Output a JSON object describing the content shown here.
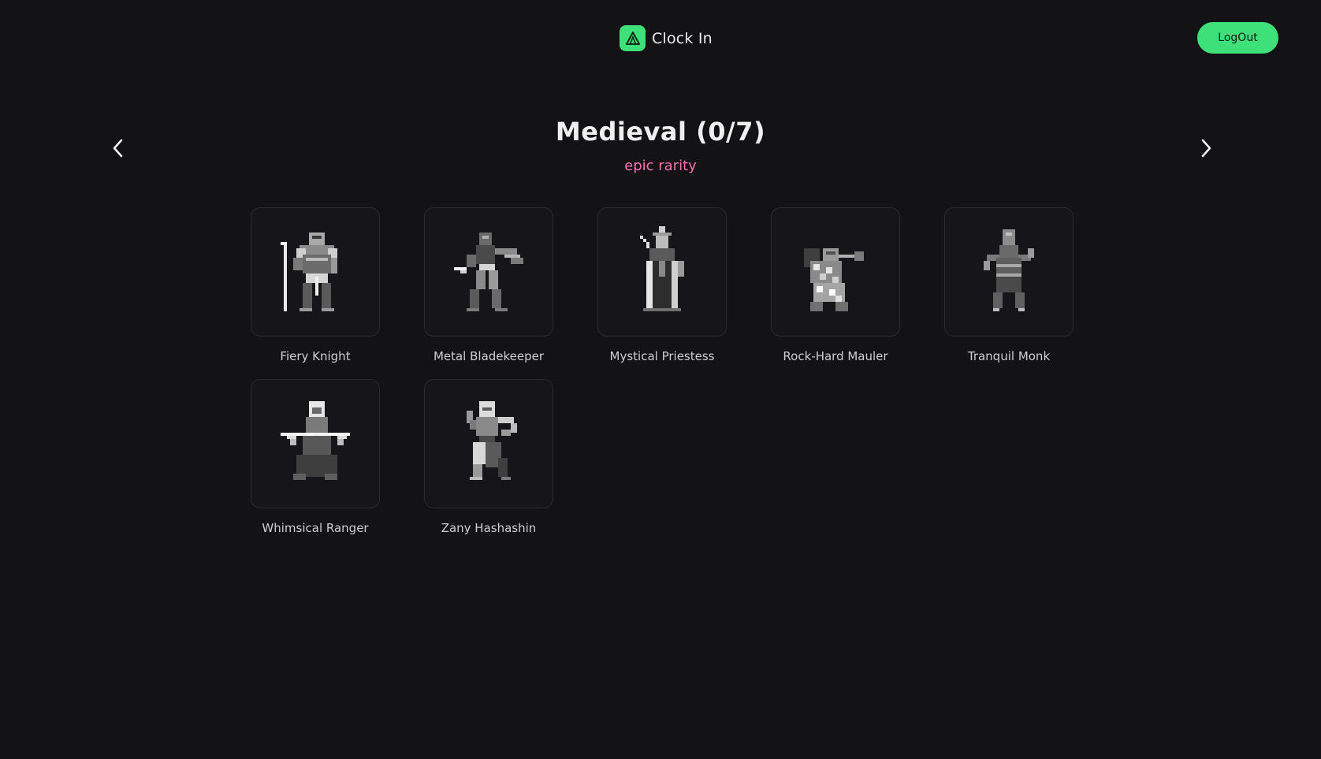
{
  "header": {
    "app_title": "Clock In",
    "logo_icon": "tent-triangle-icon",
    "logout_label": "LogOut"
  },
  "collection": {
    "title": "Medieval (0/7)",
    "rarity": "epic rarity"
  },
  "nav": {
    "prev_icon": "chevron-left-icon",
    "next_icon": "chevron-right-icon"
  },
  "characters": [
    {
      "name": "Fiery Knight"
    },
    {
      "name": "Metal Bladekeeper"
    },
    {
      "name": "Mystical Priestess"
    },
    {
      "name": "Rock-Hard Mauler"
    },
    {
      "name": "Tranquil Monk"
    },
    {
      "name": "Whimsical Ranger"
    },
    {
      "name": "Zany Hashashin"
    }
  ],
  "colors": {
    "background": "#131316",
    "accent": "#3ee07a",
    "rarity": "#ff6fb3"
  }
}
